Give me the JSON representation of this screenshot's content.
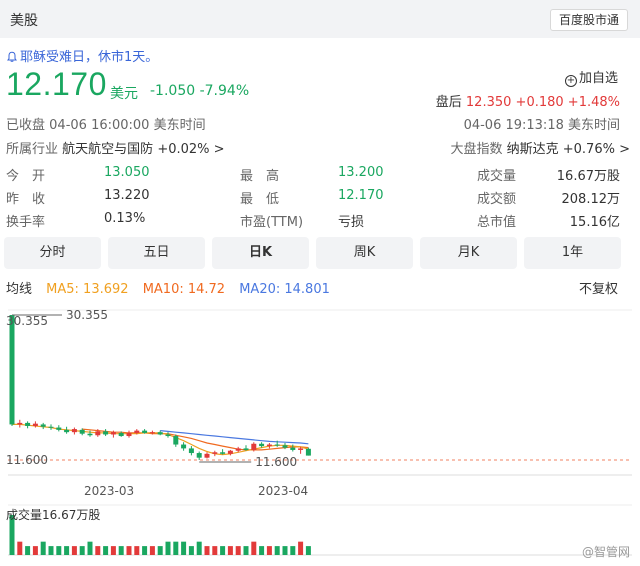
{
  "header": {
    "market": "美股",
    "app_button": "百度股市通"
  },
  "notice": "耶稣受难日，休市1天。",
  "quote": {
    "price": "12.170",
    "currency": "美元",
    "change": "-1.050",
    "change_pct": "-7.94%"
  },
  "watchlist": {
    "label": "加自选"
  },
  "after_hours": {
    "label": "盘后",
    "price": "12.350",
    "change": "+0.180",
    "change_pct": "+1.48%"
  },
  "status": {
    "text": "已收盘",
    "time": "04-06 16:00:00 美东时间",
    "after_time": "04-06 19:13:18 美东时间"
  },
  "industry": {
    "label": "所属行业",
    "name": "航天航空与国防",
    "change": "+0.02%"
  },
  "index": {
    "label": "大盘指数",
    "name": "纳斯达克",
    "change": "+0.76%"
  },
  "stats": [
    {
      "l1": "今　开",
      "v1": "13.050",
      "l2": "最　高",
      "v2": "13.200",
      "l3": "成交量",
      "v3": "16.67万股"
    },
    {
      "l1": "昨　收",
      "v1": "13.220",
      "l2": "最　低",
      "v2": "12.170",
      "l3": "成交额",
      "v3": "208.12万"
    },
    {
      "l1": "换手率",
      "v1": "0.13%",
      "l2": "市盈(TTM)",
      "v2": "亏损",
      "l3": "总市值",
      "v3": "15.16亿"
    }
  ],
  "tabs": [
    "分时",
    "五日",
    "日K",
    "周K",
    "月K",
    "1年"
  ],
  "active_tab": "日K",
  "ma": {
    "title": "均线",
    "ma5": "MA5: 13.692",
    "ma10": "MA10: 14.72",
    "ma20": "MA20: 14.801"
  },
  "adjust": "不复权",
  "colors": {
    "up": "#e23a3a",
    "down": "#1aa760",
    "ma5": "#f0a020",
    "ma10": "#f06a20",
    "ma20": "#4a78e0",
    "link": "#3a66d8"
  },
  "icons": {
    "notice": "bell-icon",
    "watchlist": "plus-circle-icon",
    "industry": "chevron-right-icon",
    "index": "chevron-right-icon"
  },
  "chart_data": {
    "type": "candlestick",
    "ylim": [
      11.6,
      30.355
    ],
    "y_labels": [
      "30.355",
      "11.600"
    ],
    "x_labels": [
      "2023-03",
      "2023-04"
    ],
    "annotations": [
      "30.355",
      "11.600"
    ],
    "volume_title": "成交量16.67万股",
    "candles": [
      [
        30.355,
        30.355,
        16.0,
        16.2,
        "d"
      ],
      [
        16.2,
        16.8,
        15.8,
        16.4,
        "u"
      ],
      [
        16.4,
        16.6,
        15.7,
        16.0,
        "d"
      ],
      [
        16.0,
        16.6,
        15.8,
        16.3,
        "u"
      ],
      [
        16.2,
        16.4,
        15.6,
        15.9,
        "d"
      ],
      [
        15.9,
        16.2,
        15.5,
        15.8,
        "d"
      ],
      [
        15.8,
        16.1,
        15.3,
        15.5,
        "d"
      ],
      [
        15.5,
        15.9,
        15.0,
        15.2,
        "d"
      ],
      [
        15.2,
        15.8,
        14.9,
        15.6,
        "u"
      ],
      [
        15.5,
        15.7,
        14.8,
        15.0,
        "d"
      ],
      [
        15.0,
        15.4,
        14.6,
        14.8,
        "d"
      ],
      [
        14.8,
        15.6,
        14.6,
        15.3,
        "u"
      ],
      [
        15.3,
        15.6,
        14.7,
        14.9,
        "d"
      ],
      [
        14.9,
        15.4,
        14.5,
        15.2,
        "u"
      ],
      [
        15.1,
        15.3,
        14.6,
        14.7,
        "d"
      ],
      [
        14.7,
        15.4,
        14.5,
        15.1,
        "u"
      ],
      [
        15.1,
        15.6,
        14.9,
        15.4,
        "u"
      ],
      [
        15.4,
        15.6,
        15.0,
        15.1,
        "d"
      ],
      [
        15.1,
        15.4,
        14.9,
        15.2,
        "u"
      ],
      [
        15.2,
        15.4,
        14.8,
        14.9,
        "d"
      ],
      [
        14.9,
        15.2,
        14.5,
        14.7,
        "d"
      ],
      [
        14.7,
        14.9,
        13.3,
        13.6,
        "d"
      ],
      [
        13.6,
        13.9,
        12.8,
        13.1,
        "d"
      ],
      [
        13.1,
        13.4,
        12.2,
        12.5,
        "d"
      ],
      [
        12.5,
        12.7,
        11.6,
        11.9,
        "d"
      ],
      [
        11.9,
        12.6,
        11.8,
        12.4,
        "u"
      ],
      [
        12.4,
        12.8,
        12.1,
        12.6,
        "u"
      ],
      [
        12.6,
        13.0,
        12.3,
        12.4,
        "d"
      ],
      [
        12.4,
        12.9,
        12.2,
        12.8,
        "u"
      ],
      [
        12.8,
        13.3,
        12.6,
        13.1,
        "u"
      ],
      [
        13.1,
        13.5,
        12.8,
        12.9,
        "d"
      ],
      [
        12.9,
        13.9,
        12.7,
        13.7,
        "u"
      ],
      [
        13.7,
        13.9,
        13.2,
        13.4,
        "d"
      ],
      [
        13.4,
        13.8,
        13.1,
        13.6,
        "u"
      ],
      [
        13.6,
        14.1,
        13.3,
        13.5,
        "d"
      ],
      [
        13.5,
        13.8,
        13.0,
        13.2,
        "d"
      ],
      [
        13.2,
        13.6,
        12.7,
        12.9,
        "d"
      ],
      [
        12.9,
        13.3,
        12.4,
        13.1,
        "u"
      ],
      [
        13.05,
        13.2,
        12.17,
        12.17,
        "d"
      ]
    ],
    "volumes": [
      9,
      3,
      2,
      2,
      3,
      2,
      2,
      2,
      2,
      2,
      3,
      2,
      2,
      2,
      2,
      2,
      2,
      2,
      2,
      2,
      3,
      3,
      3,
      2,
      3,
      2,
      2,
      2,
      2,
      2,
      2,
      3,
      2,
      2,
      2,
      2,
      2,
      3,
      2
    ],
    "ma5": [
      16.2,
      16.2,
      16.1,
      16.0,
      15.9,
      15.8,
      15.6,
      15.5,
      15.4,
      15.3,
      15.2,
      15.1,
      15.1,
      15.0,
      15.0,
      15.0,
      15.0,
      15.1,
      15.1,
      15.1,
      14.9,
      14.5,
      14.1,
      13.6,
      13.1,
      12.7,
      12.4,
      12.3,
      12.4,
      12.6,
      12.8,
      13.0,
      13.2,
      13.4,
      13.5,
      13.5,
      13.4,
      13.3,
      13.0
    ],
    "ma10": [
      null,
      null,
      null,
      null,
      null,
      null,
      null,
      null,
      null,
      15.6,
      15.5,
      15.4,
      15.3,
      15.2,
      15.2,
      15.1,
      15.1,
      15.1,
      15.0,
      15.0,
      15.0,
      14.8,
      14.6,
      14.4,
      14.1,
      13.8,
      13.6,
      13.4,
      13.2,
      13.0,
      12.9,
      12.9,
      12.9,
      13.0,
      13.1,
      13.2,
      13.3,
      13.3,
      13.2
    ],
    "ma20": [
      null,
      null,
      null,
      null,
      null,
      null,
      null,
      null,
      null,
      null,
      null,
      null,
      null,
      null,
      null,
      null,
      null,
      null,
      null,
      15.4,
      15.3,
      15.2,
      15.1,
      15.0,
      14.9,
      14.8,
      14.7,
      14.6,
      14.5,
      14.4,
      14.3,
      14.2,
      14.1,
      14.0,
      13.95,
      13.9,
      13.85,
      13.8,
      13.7
    ]
  },
  "watermark": "@智管网"
}
